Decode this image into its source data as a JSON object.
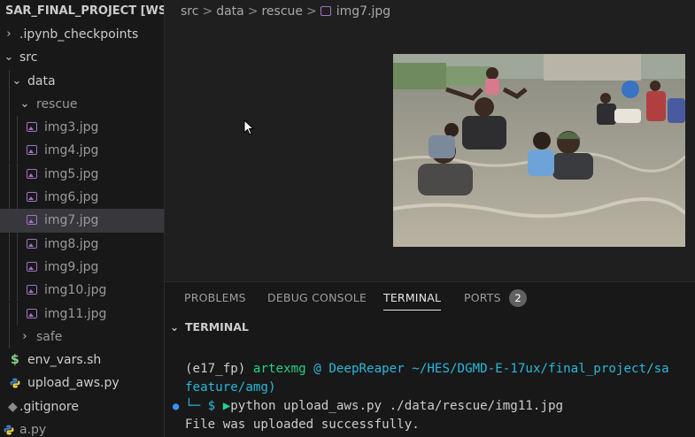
{
  "explorer": {
    "header": "SAR_FINAL_PROJECT [WSL...",
    "items": [
      {
        "label": ".ipynb_checkpoints",
        "muted": false
      },
      {
        "label": "src",
        "muted": false
      },
      {
        "label": "data",
        "muted": false
      },
      {
        "label": "rescue",
        "muted": true
      },
      {
        "label": "img3.jpg",
        "muted": true
      },
      {
        "label": "img4.jpg",
        "muted": true
      },
      {
        "label": "img5.jpg",
        "muted": true
      },
      {
        "label": "img6.jpg",
        "muted": true
      },
      {
        "label": "img7.jpg",
        "muted": true
      },
      {
        "label": "img8.jpg",
        "muted": true
      },
      {
        "label": "img9.jpg",
        "muted": true
      },
      {
        "label": "img10.jpg",
        "muted": true
      },
      {
        "label": "img11.jpg",
        "muted": true
      },
      {
        "label": "safe",
        "muted": true
      },
      {
        "label": "env_vars.sh",
        "muted": false
      },
      {
        "label": "upload_aws.py",
        "muted": false
      },
      {
        "label": ".gitignore",
        "muted": false
      },
      {
        "label": "a.py",
        "muted": false
      }
    ]
  },
  "breadcrumb": {
    "parts": [
      "src",
      "data",
      "rescue",
      "img7.jpg"
    ],
    "separator": ">"
  },
  "panel": {
    "tabs": [
      "PROBLEMS",
      "DEBUG CONSOLE",
      "TERMINAL",
      "PORTS"
    ],
    "active_tab": "TERMINAL",
    "ports_badge": "2",
    "section_title": "TERMINAL"
  },
  "terminal": {
    "line1_env": "(e17_fp)",
    "line1_user": "artexmg",
    "line1_at": "@",
    "line1_host": "DeepReaper",
    "line1_path": "~/HES/DGMD-E-17ux/final_project/sa",
    "line2": "feature/amg)",
    "prompt_prefix": "└─ $",
    "command": "python upload_aws.py ./data/rescue/img11.jpg",
    "output": "File was uploaded successfully."
  },
  "colors": {
    "image_icon": "#a074c4",
    "terminal_green": "#23d18b",
    "terminal_teal": "#29b8db",
    "selection": "#37373d"
  }
}
